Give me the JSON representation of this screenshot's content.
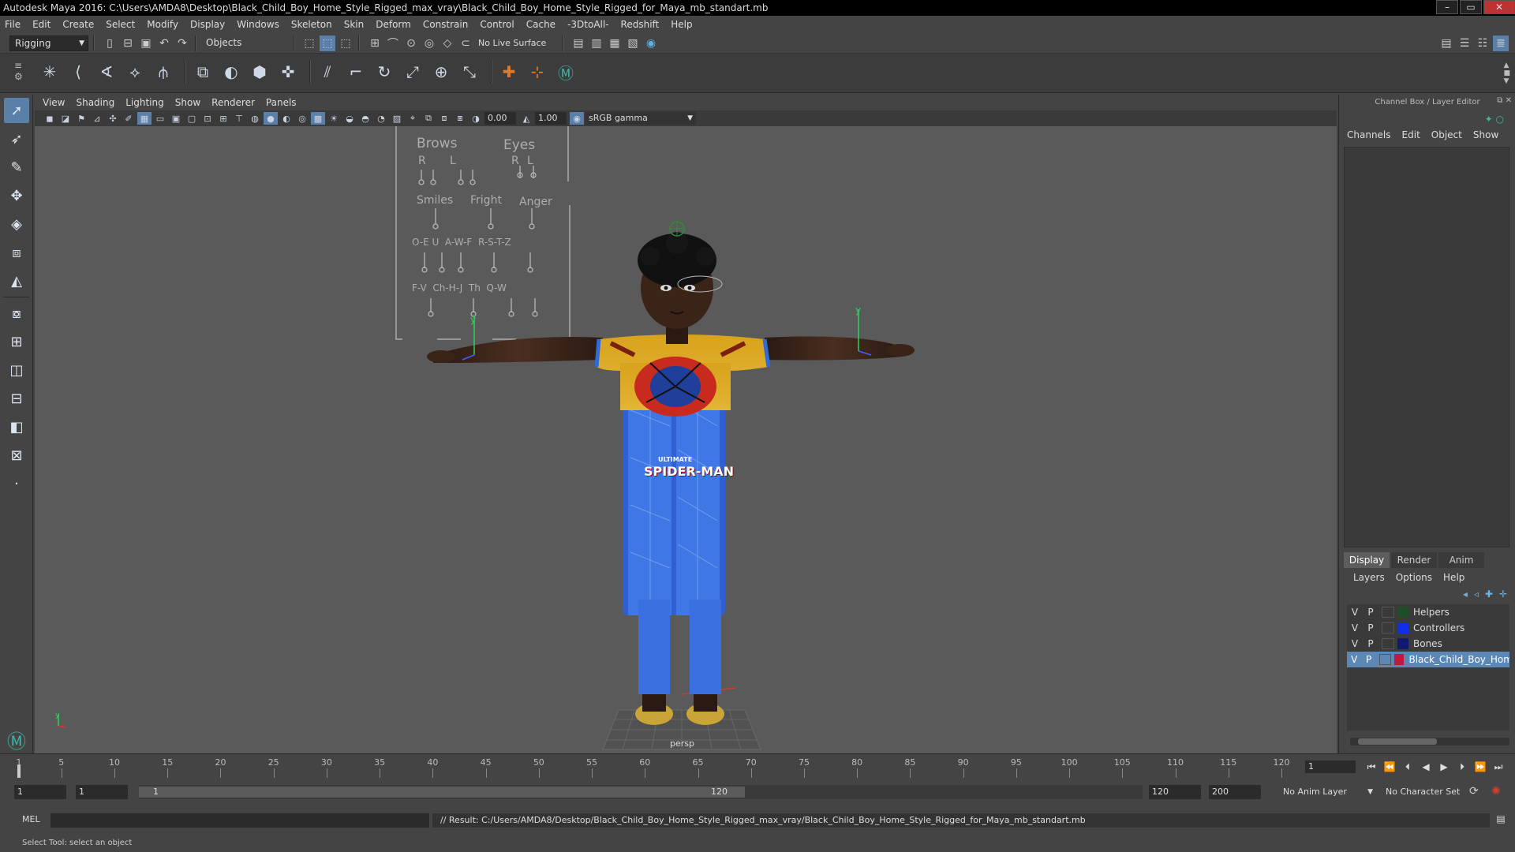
{
  "window": {
    "title": "Autodesk Maya 2016: C:\\Users\\AMDA8\\Desktop\\Black_Child_Boy_Home_Style_Rigged_max_vray\\Black_Child_Boy_Home_Style_Rigged_for_Maya_mb_standart.mb"
  },
  "menu": [
    "File",
    "Edit",
    "Create",
    "Select",
    "Modify",
    "Display",
    "Windows",
    "Skeleton",
    "Skin",
    "Deform",
    "Constrain",
    "Control",
    "Cache",
    "-3DtoAll-",
    "Redshift",
    "Help"
  ],
  "status_line": {
    "menu_set": "Rigging",
    "selection_mode": "Objects",
    "live_surface": "No Live Surface"
  },
  "viewport": {
    "menus": [
      "View",
      "Shading",
      "Lighting",
      "Show",
      "Renderer",
      "Panels"
    ],
    "exposure": "0.00",
    "gamma_value": "1.00",
    "color_space": "sRGB gamma",
    "camera": "persp",
    "shirt_text_1": "ULTIMATE",
    "shirt_text_2": "SPIDER-MAN",
    "axis_y": "y",
    "control_panel": {
      "brows": "Brows",
      "eyes": "Eyes",
      "r1": "R",
      "l1": "L",
      "r2": "R",
      "l2": "L",
      "smiles": "Smiles",
      "fright": "Fright",
      "anger": "Anger",
      "row3": "O-E U  A-W-F  R-S-T-Z",
      "row4": "F-V  Ch-H-J  Th  Q-W"
    }
  },
  "channel_box": {
    "title": "Channel Box / Layer Editor",
    "menus": [
      "Channels",
      "Edit",
      "Object",
      "Show"
    ]
  },
  "layer_editor": {
    "tabs": [
      "Display",
      "Render",
      "Anim"
    ],
    "active_tab": "Display",
    "menus": [
      "Layers",
      "Options",
      "Help"
    ],
    "layers": [
      {
        "v": "V",
        "p": "P",
        "name": "Helpers",
        "color": "#1f4f2a"
      },
      {
        "v": "V",
        "p": "P",
        "name": "Controllers",
        "color": "#1030e8"
      },
      {
        "v": "V",
        "p": "P",
        "name": "Bones",
        "color": "#101870"
      },
      {
        "v": "V",
        "p": "P",
        "name": "Black_Child_Boy_Home",
        "color": "#c01840",
        "selected": true
      }
    ]
  },
  "time_slider": {
    "ticks": [
      "1",
      "5",
      "10",
      "15",
      "20",
      "25",
      "30",
      "35",
      "40",
      "45",
      "50",
      "55",
      "60",
      "65",
      "70",
      "75",
      "80",
      "85",
      "90",
      "95",
      "100",
      "105",
      "110",
      "115",
      "120"
    ],
    "current_frame": "1"
  },
  "range_slider": {
    "start": "1",
    "playback_start": "1",
    "range_start": "1",
    "range_end": "120",
    "playback_end": "120",
    "end": "200",
    "anim_layer": "No Anim Layer",
    "character_set": "No Character Set"
  },
  "command_line": {
    "lang": "MEL",
    "result": "// Result: C:/Users/AMDA8/Desktop/Black_Child_Boy_Home_Style_Rigged_max_vray/Black_Child_Boy_Home_Style_Rigged_for_Maya_mb_standart.mb"
  },
  "help_line": "Select Tool: select an object",
  "colors": {
    "accent": "#5a7fa8",
    "layer_selected": "#5b88b6"
  }
}
